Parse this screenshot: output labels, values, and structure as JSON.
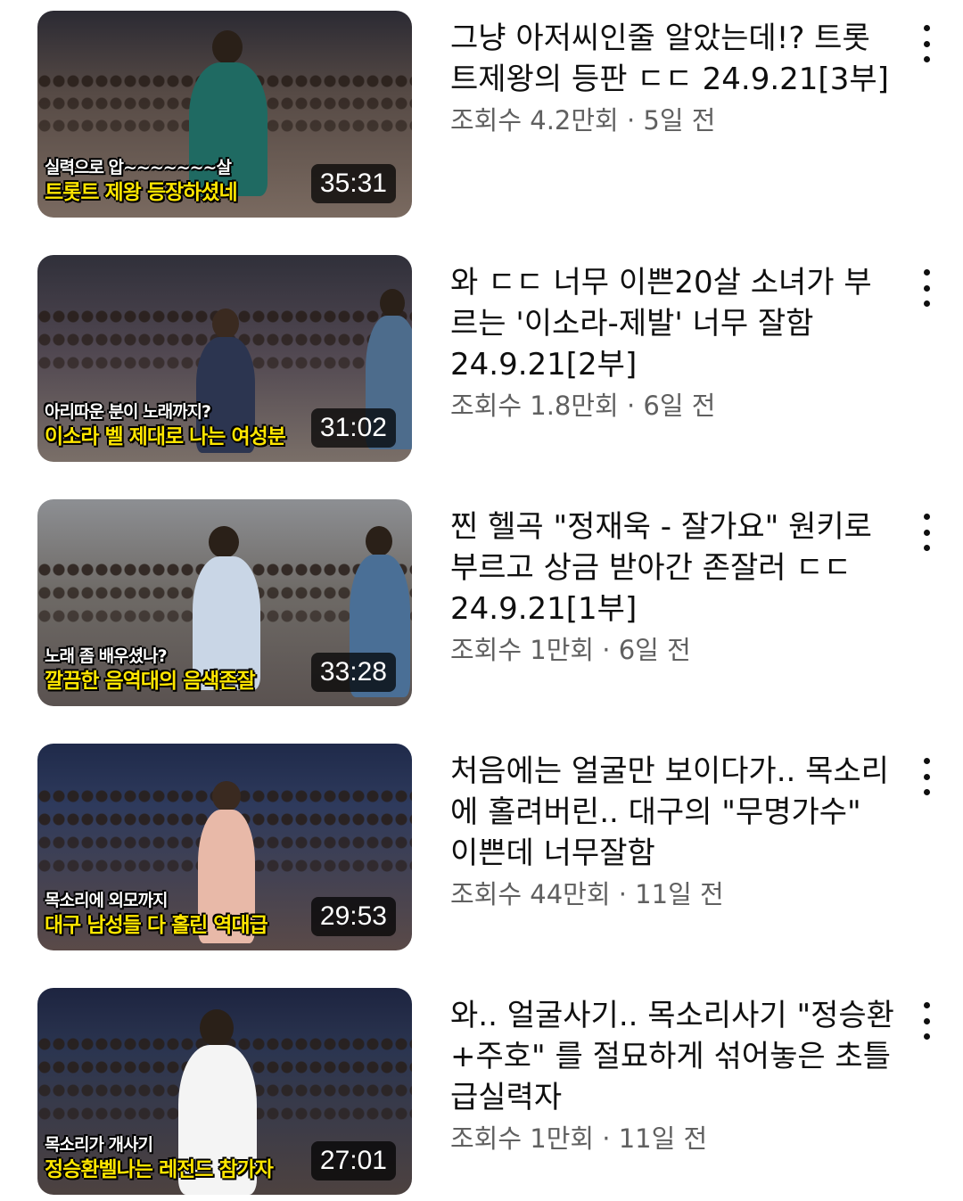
{
  "videos": [
    {
      "title": "그냥 아저씨인줄 알았는데!? 트롯트제왕의 등판 ㄷㄷ 24.9.21[3부]",
      "meta": "조회수 4.2만회 · 5일 전",
      "duration": "35:31",
      "caption_top": "실력으로 압~~~~~~~살",
      "caption_bottom": "트롯트 제왕 등장하셨네",
      "scene_color": "#5b4a42"
    },
    {
      "title": "와 ㄷㄷ 너무 이쁜20살 소녀가 부르는 '이소라-제발' 너무 잘함 24.9.21[2부]",
      "meta": "조회수 1.8만회 · 6일 전",
      "duration": "31:02",
      "caption_top": "아리따운 분이 노래까지?",
      "caption_bottom": "이소라 벨 제대로 나는 여성분",
      "scene_color": "#4f4650"
    },
    {
      "title": "찐 헬곡 \"정재욱 - 잘가요\" 원키로 부르고 상금 받아간 존잘러 ㄷㄷ 24.9.21[1부]",
      "meta": "조회수 1만회 · 6일 전",
      "duration": "33:28",
      "caption_top": "노래 좀 배우셨나?",
      "caption_bottom": "깔끔한 음역대의 음색존잘",
      "scene_color": "#6e6a66"
    },
    {
      "title": "처음에는 얼굴만 보이다가.. 목소리에 홀려버린.. 대구의 \"무명가수\" 이쁜데 너무잘함",
      "meta": "조회수 44만회 · 11일 전",
      "duration": "29:53",
      "caption_top": "목소리에 외모까지",
      "caption_bottom": "대구 남성들 다 홀린 역대급",
      "scene_color": "#2e3a5c"
    },
    {
      "title": "와.. 얼굴사기.. 목소리사기 \"정승환+주호\" 를 절묘하게 섞어놓은 초틀급실력자",
      "meta": "조회수 1만회 · 11일 전",
      "duration": "27:01",
      "caption_top": "목소리가 개사기",
      "caption_bottom": "정승환벨나는 레전드 참가자",
      "scene_color": "#2b3550"
    }
  ],
  "colors": {
    "title": "#0f0f0f",
    "meta": "#606060",
    "caption_yellow": "#ffe600",
    "duration_bg": "rgba(0,0,0,0.72)"
  },
  "icons": {
    "more": "vertical-ellipsis-icon"
  }
}
